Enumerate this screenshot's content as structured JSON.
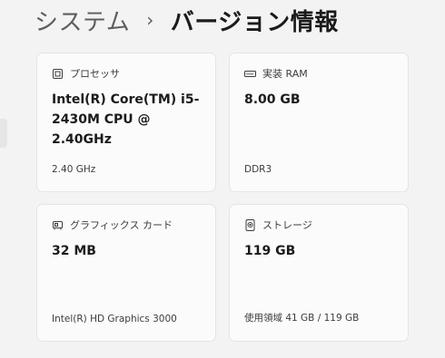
{
  "breadcrumb": {
    "parent": "システム",
    "separator": "›",
    "current": "バージョン情報"
  },
  "cards": {
    "processor": {
      "icon": "processor-icon",
      "title": "プロセッサ",
      "value": "Intel(R) Core(TM) i5-2430M CPU @ 2.40GHz",
      "sub": "2.40 GHz"
    },
    "ram": {
      "icon": "memory-icon",
      "title": "実装 RAM",
      "value": "8.00 GB",
      "sub": "DDR3"
    },
    "graphics": {
      "icon": "graphics-card-icon",
      "title": "グラフィックス カード",
      "value": "32 MB",
      "sub": "Intel(R) HD Graphics 3000"
    },
    "storage": {
      "icon": "storage-icon",
      "title": "ストレージ",
      "value": "119 GB",
      "sub": "使用領域 41 GB / 119 GB"
    }
  }
}
